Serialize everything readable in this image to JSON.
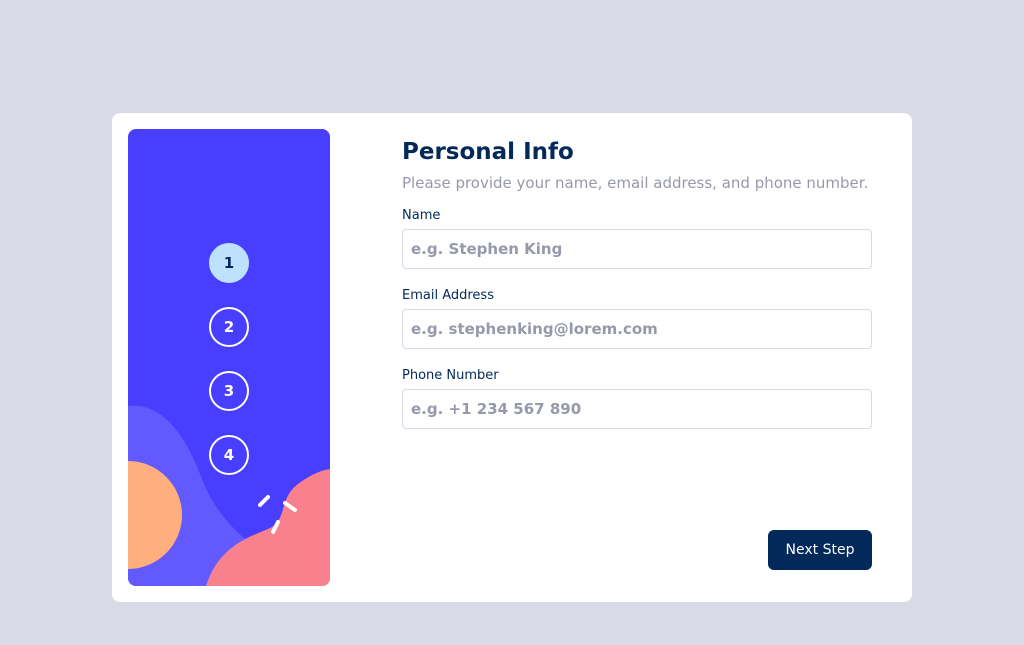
{
  "sidebar": {
    "steps": [
      {
        "number": "1",
        "active": true
      },
      {
        "number": "2",
        "active": false
      },
      {
        "number": "3",
        "active": false
      },
      {
        "number": "4",
        "active": false
      }
    ]
  },
  "form": {
    "title": "Personal Info",
    "subtitle": "Please provide your name, email address, and phone number.",
    "fields": [
      {
        "label": "Name",
        "placeholder": "e.g. Stephen King",
        "value": ""
      },
      {
        "label": "Email Address",
        "placeholder": "e.g. stephenking@lorem.com",
        "value": ""
      },
      {
        "label": "Phone Number",
        "placeholder": "e.g. +1 234 567 890",
        "value": ""
      }
    ]
  },
  "actions": {
    "next_label": "Next Step"
  },
  "colors": {
    "background": "#d8dbe5",
    "sidebar": "#483eff",
    "active_step": "#bee2fd",
    "primary": "#02295a",
    "muted": "#9699ab",
    "deco_purple": "#6259ff",
    "deco_orange": "#ffaf7e",
    "deco_pink": "#f9818e"
  }
}
